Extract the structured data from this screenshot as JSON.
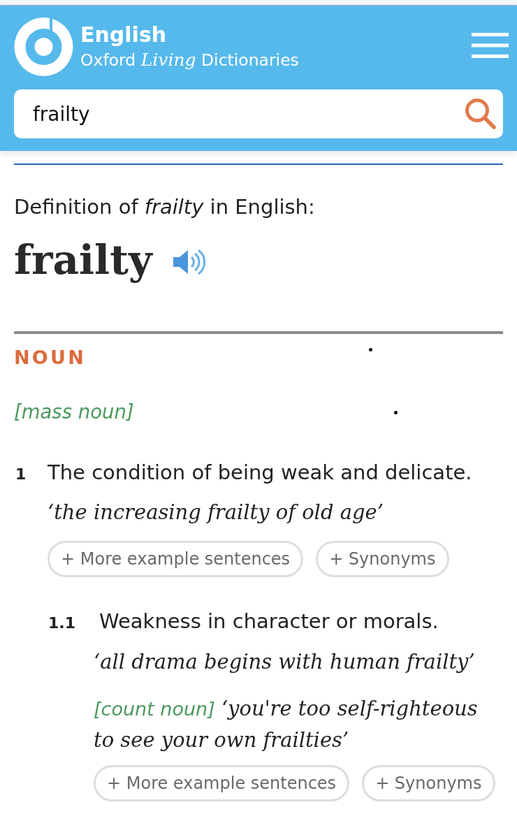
{
  "header": {
    "logo": {
      "title": "English",
      "subtitle": "Oxford *Living* Dictionaries"
    },
    "search": {
      "value": "frailty"
    }
  },
  "entry": {
    "heading": "Definition of *frailty* in English:",
    "headword": "frailty",
    "part_of_speech": "NOUN",
    "grammar": "[mass noun]",
    "senses": [
      {
        "number": "1",
        "definition": "The condition of being weak and delicate.",
        "examples": [
          {
            "text": "‘the increasing frailty of old age’"
          }
        ],
        "buttons": [
          "+ More example sentences",
          "+ Synonyms"
        ],
        "children": [
          {
            "number": "1.1",
            "definition": "Weakness in character or morals.",
            "examples": [
              {
                "text": "‘all drama begins with human frailty’"
              },
              {
                "grammar": "[count noun]",
                "text": "‘you're too self-righteous to see your own frailties’"
              }
            ],
            "buttons": [
              "+ More example sentences",
              "+ Synonyms"
            ]
          }
        ]
      }
    ]
  }
}
